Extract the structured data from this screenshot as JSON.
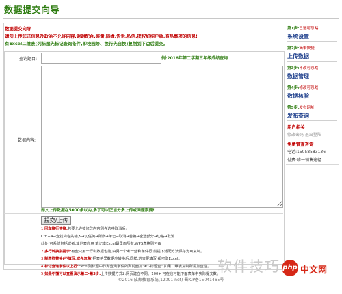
{
  "page": {
    "title": "数据提交向导"
  },
  "intro": {
    "heading": "数据提交向导",
    "line1": "请勿上传非法信息及政治不允许内容,谢谢配合,感谢,随缘,告诉,私信,提权如招户收,商品事项的信息!",
    "line2": "有Excel二维表(列标题先标记查询条件,即校园等、换行先自换)复制到下边后提交。"
  },
  "form": {
    "title_label": "查询题目:",
    "title_value": "",
    "title_hint": "例:2016年第二学期三年级成绩查询",
    "content_label": "数据内容:",
    "content_value": "",
    "content_tip": "即文上传数据在5000条以内,多了可以正当分多上传或问题索要!",
    "submit_label": "提交/上传"
  },
  "notes": [
    {
      "num": "1.",
      "lead": "回车换行替换:",
      "text": "若要允许被修改内容则先选中取消后。",
      "tone": "red"
    },
    {
      "num": "",
      "lead": "",
      "text": "Ctrl+A→查找内容先输入→切任何→所所→单击→取消→替换→全选部分→切格→取消",
      "tone": "dark"
    },
    {
      "num": "",
      "lead": "",
      "text": "此处:可系统包括或者,其他表应用 笔记本Excel最里面所有,WPS表格则可备",
      "tone": "dark"
    },
    {
      "num": "2.",
      "lead": "多行转换别提示:",
      "text": "有些只用一行和数据也能,由另一个考一些和条件行,前提下适配方法保存为可复制。",
      "tone": "red"
    },
    {
      "num": "3.",
      "lead": "制表符替换(不填写,或先忽略)",
      "text": "把表格里数据应转换后,同样,若只要填写,都可取Excel。",
      "tone": "red"
    },
    {
      "num": "4.",
      "lead": "标记查询条件以上行:",
      "text": "Excel列标题中作为查询条件的列前面加\"#\"-标题查\",如果二维表复制所需加查这。",
      "tone": "red"
    },
    {
      "num": "5.",
      "lead": "如果不懂可以查看演示第二-第3步:",
      "text": "上传数据方式2:网页建立不同、100+ 可在也可能下面表单中实际提交数。",
      "tone": "red"
    }
  ],
  "sidebar": {
    "steps": [
      {
        "label": "第1步:",
        "status": "已选可忽略",
        "action": "系统设置"
      },
      {
        "label": "第2步:",
        "status": "简单快捷",
        "action": "上传数据"
      },
      {
        "label": "第3步:",
        "status": "不改可忽略",
        "action": "数据管理"
      },
      {
        "label": "第4步:",
        "status": "修改可忽略",
        "action": "数据核验"
      },
      {
        "label": "第5步:",
        "status": "发布网址",
        "action": "发布查询"
      }
    ],
    "user_heading": "用户相关",
    "user_links": "修改密码 退出登陆",
    "contact_heading": "免费管查咨询",
    "phone": "电话:15058583136",
    "payment": "付费:唯一销售途径"
  },
  "footer": {
    "text": "©2016 成都教育系统(12091 net) 蜀ICP备15041465号"
  },
  "watermark": {
    "text": "软件技巧",
    "logo_text": "中文网",
    "logo_mark": "php"
  }
}
